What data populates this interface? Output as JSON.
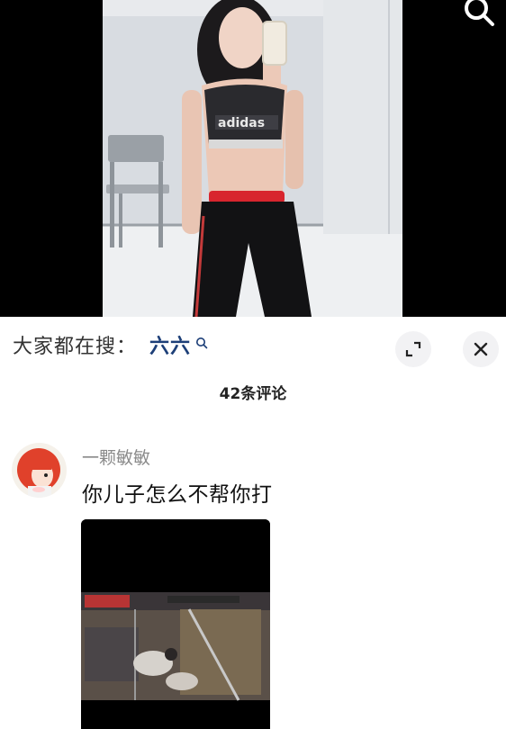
{
  "search": {
    "prefix": "大家都在搜：",
    "keyword": "六六"
  },
  "comments": {
    "count_label": "42条评论",
    "items": [
      {
        "username": "一颗敏敏",
        "text": "你儿子怎么不帮你打",
        "has_image": true
      }
    ]
  },
  "icons": {
    "top_right": "search-icon",
    "keyword": "search-icon",
    "expand": "expand-icon",
    "close": "close-icon"
  },
  "colors": {
    "keyword": "#1d3f78",
    "username": "#8a8a8a",
    "button_bg": "#f2f2f4"
  }
}
